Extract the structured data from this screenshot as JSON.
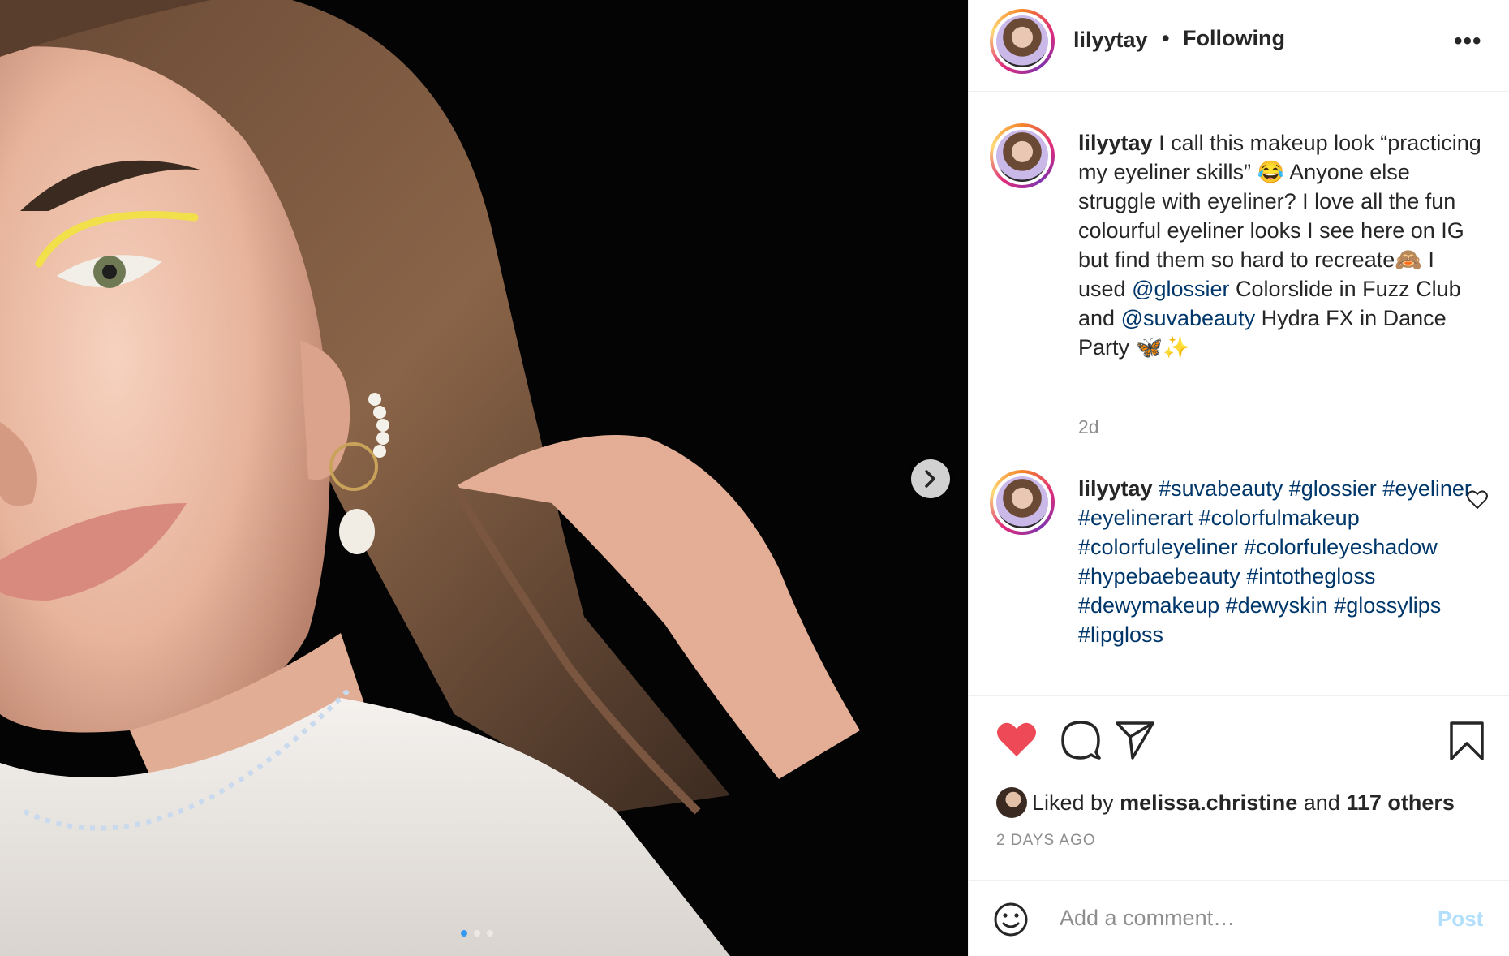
{
  "post": {
    "username": "lilyytay",
    "separator": "•",
    "follow_status": "Following",
    "more_label": "•••"
  },
  "caption": {
    "username": "lilyytay",
    "text_1": "I call this makeup look “practicing my eyeliner skills” 😂 Anyone else struggle with eyeliner? I love all the fun colourful eyeliner looks I see here on IG but find them so hard to recreate🙈 I used",
    "mention_1": "@glossier",
    "text_2": "Colorslide in Fuzz Club and",
    "mention_2": "@suvabeauty",
    "text_3": "Hydra FX in Dance Party 🦋✨",
    "time": "2d"
  },
  "hashtag_comment": {
    "username": "lilyytay",
    "tags": [
      "#suvabeauty",
      "#glossier",
      "#eyeliner",
      "#eyelinerart",
      "#colorfulmakeup",
      "#colorfuleyeliner",
      "#colorfuleyeshadow",
      "#hypebaebeauty",
      "#intothegloss",
      "#dewymakeup",
      "#dewyskin",
      "#glossylips",
      "#lipgloss"
    ]
  },
  "likes": {
    "prefix": "Liked by",
    "liker": "melissa.christine",
    "conj": "and",
    "others": "117 others"
  },
  "posted": "2 DAYS AGO",
  "comment_box": {
    "placeholder": "Add a comment…",
    "post_label": "Post"
  },
  "colors": {
    "like_red": "#ed4956",
    "link_blue": "#00376b",
    "post_disabled": "#b2dffc"
  },
  "carousel": {
    "total": 3,
    "active": 1
  }
}
